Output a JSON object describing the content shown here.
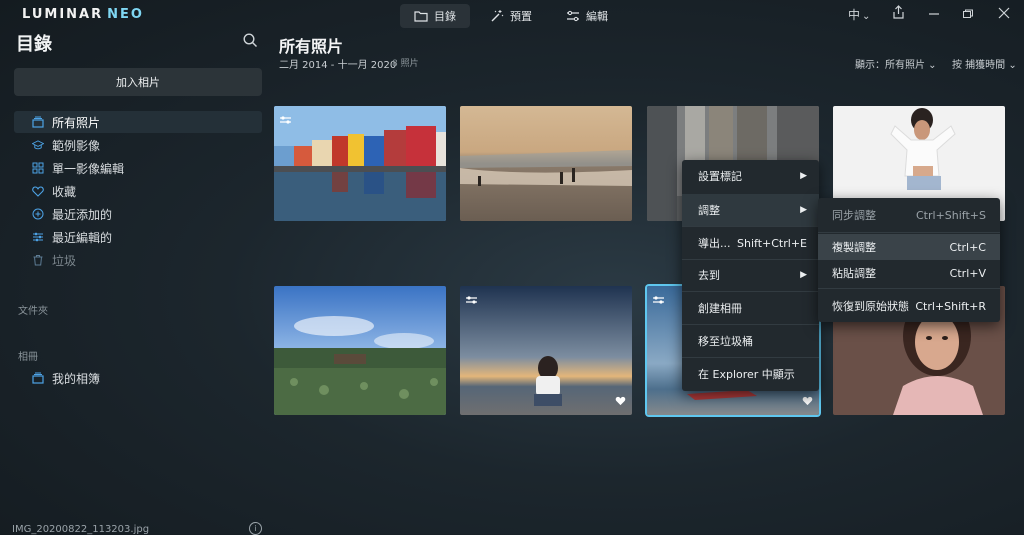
{
  "app": {
    "logo_main": "LUMINAR",
    "logo_accent": "NEO"
  },
  "topnav": [
    {
      "label": "目錄",
      "icon": "folder-icon",
      "active": true
    },
    {
      "label": "預置",
      "icon": "magic-wand-icon",
      "active": false
    },
    {
      "label": "編輯",
      "icon": "sliders-icon",
      "active": false
    }
  ],
  "window": {
    "language": "中",
    "language_chevron": "⌄"
  },
  "sidebar": {
    "title": "目錄",
    "add_button": "加入相片",
    "items": [
      {
        "label": "所有照片",
        "icon": "photos-stack-icon"
      },
      {
        "label": "範例影像",
        "icon": "graduation-cap-icon"
      },
      {
        "label": "單一影像編輯",
        "icon": "grid-icon"
      },
      {
        "label": "收藏",
        "icon": "heart-icon"
      },
      {
        "label": "最近添加的",
        "icon": "plus-circle-icon"
      },
      {
        "label": "最近編輯的",
        "icon": "sliders-icon"
      },
      {
        "label": "垃圾",
        "icon": "trash-icon"
      }
    ],
    "folders_header": "文件夾",
    "albums_header": "相冊",
    "albums": [
      {
        "label": "我的相簿",
        "icon": "album-icon"
      }
    ],
    "filename": "IMG_20200822_113203.jpg"
  },
  "main": {
    "title": "所有照片",
    "date_range": "二月 2014 - 十一月 2020",
    "count": "8 照片",
    "view_show": "顯示：所有照片 ⌄",
    "view_sort": "按 捕獲時間 ⌄"
  },
  "context_menu": {
    "items": [
      {
        "label": "設置標記",
        "shortcut": "",
        "arrow": "▶"
      },
      {
        "label": "調整",
        "shortcut": "",
        "arrow": "▶"
      },
      {
        "label": "導出...",
        "shortcut": "Shift+Ctrl+E",
        "arrow": ""
      },
      {
        "label": "去到",
        "shortcut": "",
        "arrow": "▶"
      },
      {
        "label": "創建相冊",
        "shortcut": "",
        "arrow": ""
      },
      {
        "label": "移至垃圾桶",
        "shortcut": "",
        "arrow": ""
      },
      {
        "label": "在 Explorer 中顯示",
        "shortcut": "",
        "arrow": ""
      }
    ]
  },
  "submenu": {
    "items": [
      {
        "label": "同步調整",
        "shortcut": "Ctrl+Shift+S"
      },
      {
        "label": "複製調整",
        "shortcut": "Ctrl+C"
      },
      {
        "label": "粘貼調整",
        "shortcut": "Ctrl+V"
      },
      {
        "label": "恢復到原始狀態",
        "shortcut": "Ctrl+Shift+R"
      }
    ]
  },
  "colors": {
    "accent": "#4da3e6",
    "selection_border": "#5fc7ef",
    "menu_bg": "#22292e"
  }
}
